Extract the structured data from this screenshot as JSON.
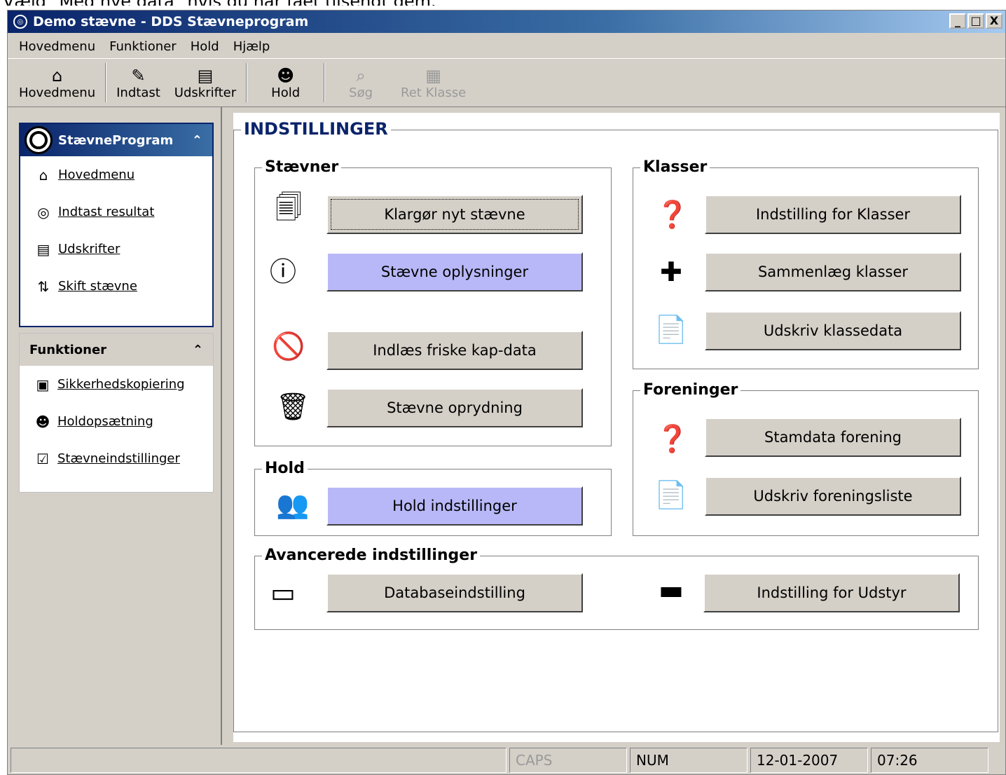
{
  "cut_text": "Vælg \"Med nye data\" hvis du har fået tilsendt dem.",
  "window": {
    "title": "Demo stævne - DDS Stævneprogram",
    "controls": [
      "_",
      "□",
      "X"
    ]
  },
  "menu": [
    "Hovedmenu",
    "Funktioner",
    "Hold",
    "Hjælp"
  ],
  "toolbar": [
    {
      "label": "Hovedmenu",
      "icon": "home-icon",
      "glyph": "⌂",
      "enabled": true
    },
    {
      "label": "Indtast",
      "icon": "pencil-icon",
      "glyph": "✎",
      "enabled": true
    },
    {
      "label": "Udskrifter",
      "icon": "printer-icon",
      "glyph": "▤",
      "enabled": true
    },
    {
      "label": "Hold",
      "icon": "team-icon",
      "glyph": "☻",
      "enabled": true
    },
    {
      "label": "Søg",
      "icon": "search-icon",
      "glyph": "⌕",
      "enabled": false
    },
    {
      "label": "Ret Klasse",
      "icon": "edit-class-icon",
      "glyph": "▦",
      "enabled": false
    }
  ],
  "sidebar": {
    "panel1": {
      "title": "StævneProgram",
      "items": [
        {
          "label": "Hovedmenu",
          "icon": "home-icon",
          "glyph": "⌂"
        },
        {
          "label": "Indtast resultat",
          "icon": "target-icon",
          "glyph": "◎"
        },
        {
          "label": "Udskrifter",
          "icon": "printer-icon",
          "glyph": "▤"
        },
        {
          "label": "Skift stævne",
          "icon": "switch-icon",
          "glyph": "⇅"
        }
      ]
    },
    "panel2": {
      "title": "Funktioner",
      "items": [
        {
          "label": "Sikkerhedskopiering",
          "icon": "save-icon",
          "glyph": "▣"
        },
        {
          "label": "Holdopsætning",
          "icon": "team-icon",
          "glyph": "☻"
        },
        {
          "label": "Stævneindstillinger",
          "icon": "settings-check-icon",
          "glyph": "☑"
        }
      ]
    },
    "collapse_glyph": "⌃"
  },
  "main": {
    "title": "INDSTILLINGER",
    "staevner": {
      "title": "Stævner",
      "buttons": [
        "Klargør nyt stævne",
        "Stævne oplysninger",
        "Indlæs friske kap-data",
        "Stævne oprydning"
      ]
    },
    "hold": {
      "title": "Hold",
      "buttons": [
        "Hold indstillinger"
      ]
    },
    "klasser": {
      "title": "Klasser",
      "buttons": [
        "Indstilling for Klasser",
        "Sammenlæg klasser",
        "Udskriv klassedata"
      ]
    },
    "foreninger": {
      "title": "Foreninger",
      "buttons": [
        "Stamdata forening",
        "Udskriv foreningsliste"
      ]
    },
    "avanceret": {
      "title": "Avancerede indstillinger",
      "buttons": [
        "Databaseindstilling",
        "Indstilling for Udstyr"
      ]
    }
  },
  "status": [
    "",
    "CAPS",
    "NUM",
    "12-01-2007",
    "07:26"
  ]
}
